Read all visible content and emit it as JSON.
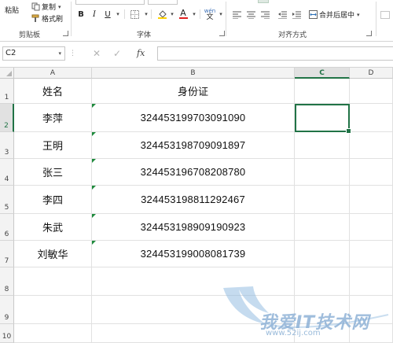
{
  "ribbon": {
    "clipboard": {
      "paste_label": "粘贴",
      "copy_label": "复制",
      "format_painter_label": "格式刷",
      "group_label": "剪贴板"
    },
    "font": {
      "bold": "B",
      "italic": "I",
      "underline": "U",
      "font_color_glyph": "A",
      "phonetic_glyph": "wén",
      "group_label": "字体"
    },
    "alignment": {
      "merge_label": "合并后居中",
      "group_label": "对齐方式"
    }
  },
  "formula_bar": {
    "name_box": "C2",
    "fx_label": "fx",
    "value": ""
  },
  "sheet": {
    "columns": [
      "A",
      "B",
      "C",
      "D"
    ],
    "selected_column": "C",
    "rows": [
      "1",
      "2",
      "3",
      "4",
      "5",
      "6",
      "7",
      "8",
      "9",
      "10"
    ],
    "selected_row": "2",
    "header": {
      "name": "姓名",
      "id": "身份证"
    },
    "records": [
      {
        "name": "李萍",
        "id": "324453199703091090"
      },
      {
        "name": "王明",
        "id": "324453198709091897"
      },
      {
        "name": "张三",
        "id": "324453196708208780"
      },
      {
        "name": "李四",
        "id": "324453198811292467"
      },
      {
        "name": "朱武",
        "id": "324453198909190923"
      },
      {
        "name": "刘敏华",
        "id": "324453199008081739"
      }
    ],
    "active_cell": "C2"
  },
  "watermark": {
    "text": "我爱IT技术网",
    "url": "www.52ij.com"
  },
  "colors": {
    "accent": "#217346",
    "marker": "#1e8a3c",
    "font_color_bar": "#e02020",
    "fill_color_bar": "#ffd200"
  }
}
